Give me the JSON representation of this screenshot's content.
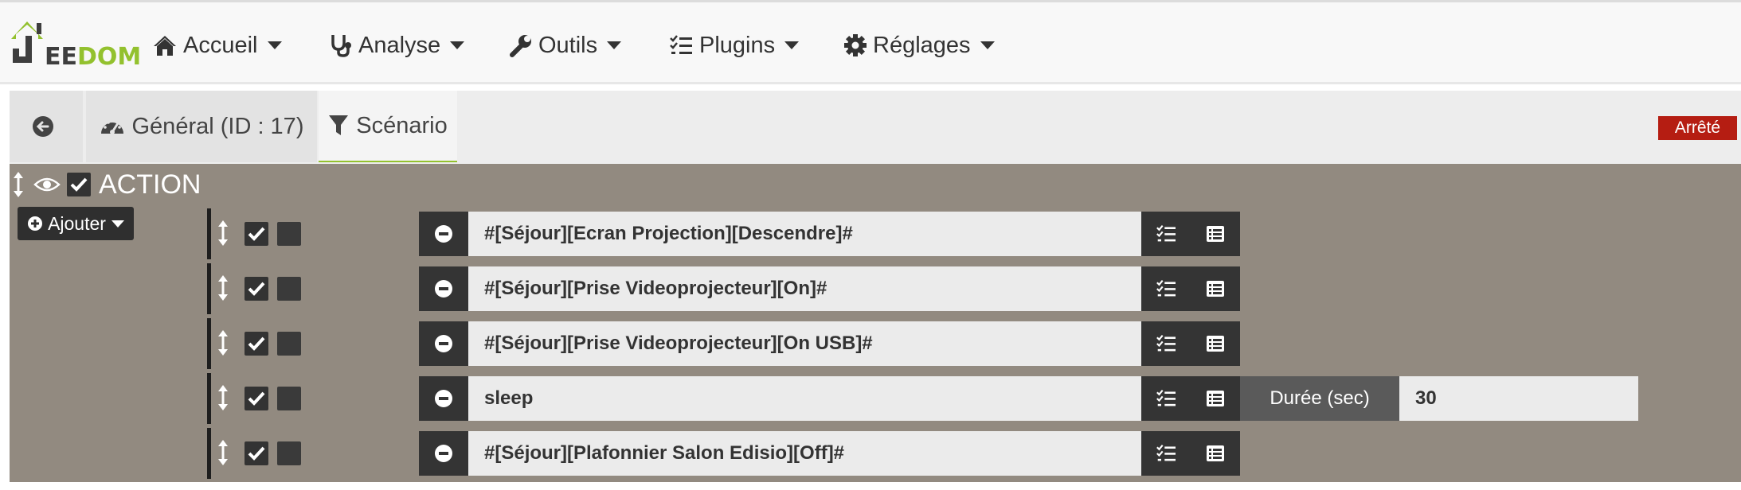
{
  "navbar": {
    "logo": {
      "text_part1": "EE",
      "text_part2": "DOM"
    },
    "items": [
      {
        "label": "Accueil",
        "icon": "home-icon"
      },
      {
        "label": "Analyse",
        "icon": "stethoscope-icon"
      },
      {
        "label": "Outils",
        "icon": "wrench-icon"
      },
      {
        "label": "Plugins",
        "icon": "tasks-icon"
      },
      {
        "label": "Réglages",
        "icon": "gear-icon"
      }
    ]
  },
  "tabs": {
    "back_icon": "arrow-circle-left-icon",
    "general": {
      "label": "Général (ID : 17)",
      "icon": "tachometer-icon"
    },
    "scenario": {
      "label": "Scénario",
      "icon": "filter-icon"
    }
  },
  "status": {
    "label": "Arrêté",
    "color": "#b51d12"
  },
  "block": {
    "title": "ACTION",
    "add_label": "Ajouter",
    "background": "#928a80"
  },
  "actions": [
    {
      "command": "#[Séjour][Ecran Projection][Descendre]#",
      "enabled": true,
      "background": false
    },
    {
      "command": "#[Séjour][Prise Videoprojecteur][On]#",
      "enabled": true,
      "background": false
    },
    {
      "command": "#[Séjour][Prise Videoprojecteur][On USB]#",
      "enabled": true,
      "background": false
    },
    {
      "command": "sleep",
      "enabled": true,
      "background": false,
      "option_label": "Durée (sec)",
      "option_value": "30"
    },
    {
      "command": "#[Séjour][Plafonnier Salon Edisio][Off]#",
      "enabled": true,
      "background": false
    }
  ],
  "colors": {
    "accent_green": "#93c12e",
    "button_dark": "#343434"
  }
}
